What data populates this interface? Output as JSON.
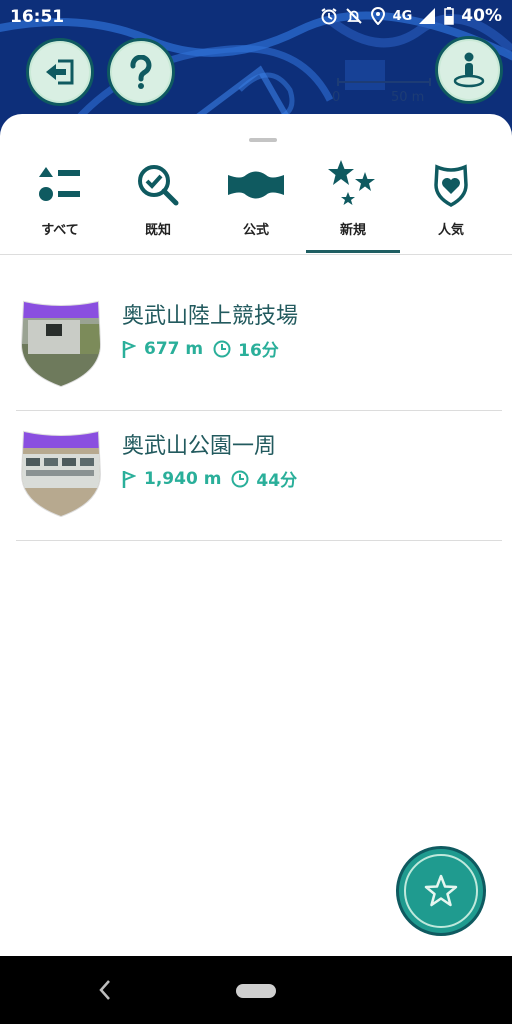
{
  "status_bar": {
    "time": "16:51",
    "network": "4G",
    "battery": "40%"
  },
  "map": {
    "scale_start": "0",
    "scale_end": "50 m"
  },
  "tabs": [
    {
      "label": "すべて",
      "icon": "list-icon"
    },
    {
      "label": "既知",
      "icon": "magnify-check-icon"
    },
    {
      "label": "公式",
      "icon": "banner-icon"
    },
    {
      "label": "新規",
      "icon": "stars-icon",
      "selected": true
    },
    {
      "label": "人気",
      "icon": "heart-shield-icon"
    }
  ],
  "routes": [
    {
      "title": "奥武山陸上競技場",
      "distance": "677 m",
      "duration": "16分"
    },
    {
      "title": "奥武山公園一周",
      "distance": "1,940 m",
      "duration": "44分"
    }
  ],
  "colors": {
    "accent": "#2aaf9a",
    "title": "#225a5e",
    "dark_teal": "#0f5a60",
    "badge_purple": "#8a4fe0"
  }
}
